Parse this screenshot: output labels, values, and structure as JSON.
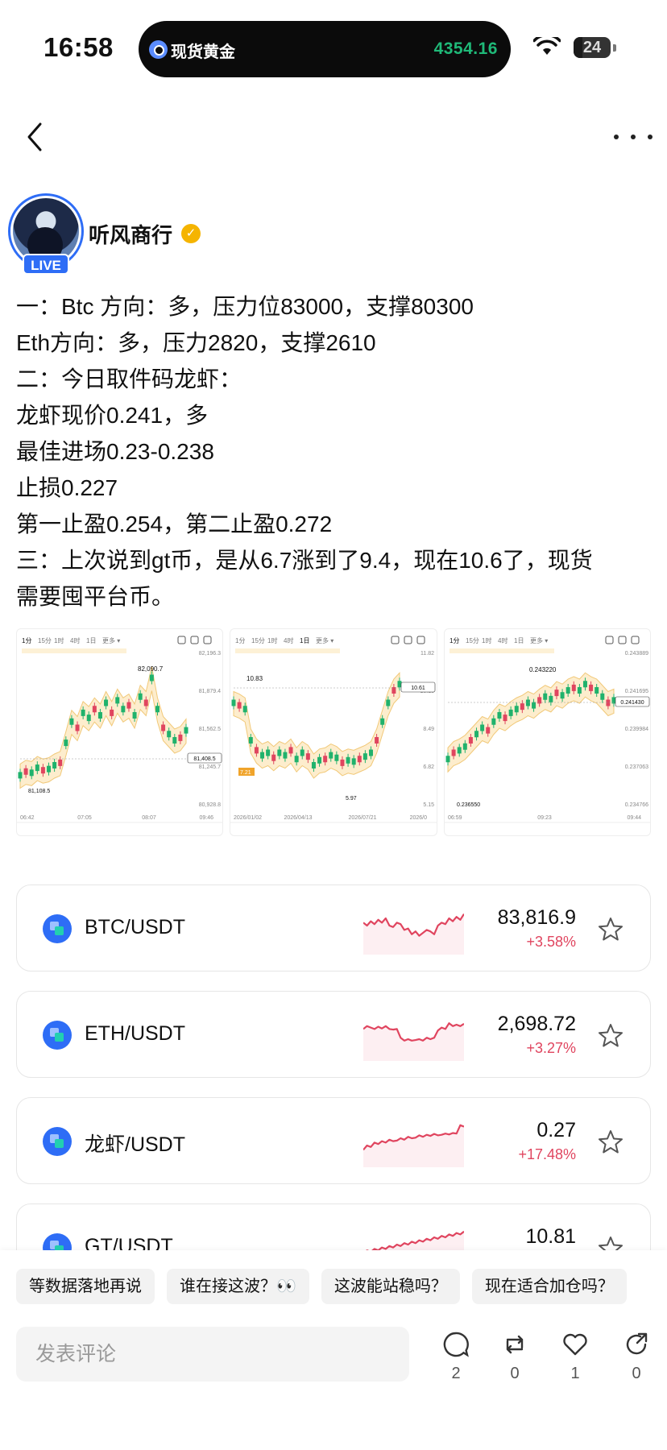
{
  "status_bar": {
    "time": "16:58",
    "island_label": "现货黄金",
    "island_price": "4354.16",
    "battery": "24",
    "battery_level": 0.24
  },
  "author": {
    "name": "听风商行",
    "live_label": "LIVE"
  },
  "post": {
    "lines": [
      "一：Btc 方向：多，压力位83000，支撑80300",
      "Eth方向：多，压力2820，支撑2610",
      "二：今日取件码龙虾：",
      "龙虾现价0.241，多",
      "最佳进场0.23-0.238",
      "止损0.227",
      "第一止盈0.254，第二止盈0.272",
      "三：上次说到gt币，是从6.7涨到了9.4，现在10.6了，现货",
      "需要囤平台币。"
    ]
  },
  "chart_images": [
    {
      "tabs": [
        "1分",
        "15分",
        "1时",
        "4时",
        "1日",
        "更多"
      ],
      "high_label": "82,090.7",
      "current_label": "81,408.5",
      "low_label": "81,108.5",
      "y_ticks": [
        "82,196.3",
        "81,879.4",
        "81,562.5",
        "81,245.7",
        "80,928.8"
      ],
      "x_ticks": [
        "06:42",
        "07:05",
        "08:07",
        "09:46"
      ]
    },
    {
      "tabs": [
        "1分",
        "15分",
        "1时",
        "4时",
        "1日",
        "更多"
      ],
      "high_label": "10.83",
      "current_label": "10.61",
      "low_label": "5.97",
      "extra_label": "7.21",
      "y_ticks": [
        "11.82",
        "10.15",
        "8.49",
        "6.82",
        "5.15"
      ],
      "x_ticks": [
        "2026/01/02",
        "2026/04/13",
        "2026/07/21",
        "2026/0"
      ]
    },
    {
      "tabs": [
        "1分",
        "15分",
        "1时",
        "4时",
        "1日",
        "更多"
      ],
      "high_label": "0.243220",
      "current_label": "0.241430",
      "low_label": "0.236550",
      "y_ticks": [
        "0.243889",
        "0.241695",
        "0.239984",
        "0.237063",
        "0.234766"
      ],
      "x_ticks": [
        "06:59",
        "09:23",
        "09:44"
      ]
    }
  ],
  "markets": [
    {
      "pair": "BTC/USDT",
      "price": "83,816.9",
      "change": "+3.58%",
      "spark": [
        0.6,
        0.5,
        0.65,
        0.55,
        0.7,
        0.6,
        0.75,
        0.5,
        0.45,
        0.6,
        0.55,
        0.35,
        0.4,
        0.2,
        0.3,
        0.15,
        0.25,
        0.35,
        0.3,
        0.2,
        0.5,
        0.6,
        0.55,
        0.75,
        0.65,
        0.8,
        0.7,
        0.9
      ]
    },
    {
      "pair": "ETH/USDT",
      "price": "2,698.72",
      "change": "+3.27%",
      "spark": [
        0.6,
        0.7,
        0.65,
        0.6,
        0.68,
        0.62,
        0.7,
        0.6,
        0.58,
        0.6,
        0.3,
        0.2,
        0.25,
        0.2,
        0.22,
        0.25,
        0.2,
        0.3,
        0.25,
        0.3,
        0.55,
        0.65,
        0.6,
        0.8,
        0.7,
        0.75,
        0.7,
        0.78
      ]
    },
    {
      "pair": "龙虾/USDT",
      "price": "0.27",
      "change": "+17.48%",
      "spark": [
        0.1,
        0.25,
        0.2,
        0.35,
        0.3,
        0.4,
        0.35,
        0.45,
        0.4,
        0.42,
        0.5,
        0.45,
        0.55,
        0.5,
        0.52,
        0.6,
        0.55,
        0.62,
        0.58,
        0.65,
        0.6,
        0.62,
        0.66,
        0.63,
        0.68,
        0.66,
        0.95,
        0.9
      ]
    },
    {
      "pair": "GT/USDT",
      "price": "10.81",
      "change": "",
      "spark": [
        0.2,
        0.3,
        0.25,
        0.35,
        0.3,
        0.4,
        0.35,
        0.45,
        0.4,
        0.5,
        0.45,
        0.55,
        0.5,
        0.6,
        0.55,
        0.65,
        0.6,
        0.7,
        0.65,
        0.75,
        0.7,
        0.8,
        0.75,
        0.85,
        0.8,
        0.9,
        0.85,
        0.95
      ]
    }
  ],
  "quick_replies": [
    "等数据落地再说",
    "谁在接这波？👀",
    "这波能站稳吗？",
    "现在适合加仓吗？"
  ],
  "comment": {
    "placeholder": "发表评论"
  },
  "actions": [
    {
      "name": "comment",
      "count": "2"
    },
    {
      "name": "repost",
      "count": "0"
    },
    {
      "name": "like",
      "count": "1"
    },
    {
      "name": "share",
      "count": "0"
    }
  ],
  "colors": {
    "accent": "#2e6df6",
    "up_red": "#e0455f",
    "gold_price": "#1fb978"
  }
}
